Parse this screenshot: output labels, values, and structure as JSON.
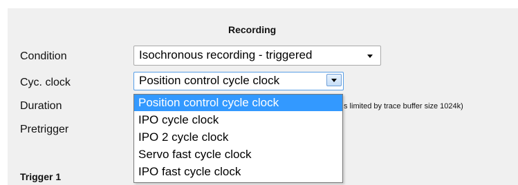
{
  "recording": {
    "title": "Recording",
    "condition": {
      "label": "Condition",
      "value": "Isochronous recording - triggered"
    },
    "cyc_clock": {
      "label": "Cyc. clock",
      "value": "Position control cycle clock",
      "options": [
        "Position control cycle clock",
        "IPO cycle clock",
        "IPO 2 cycle clock",
        "Servo fast cycle clock",
        "IPO fast cycle clock"
      ],
      "highlighted_index": 0
    },
    "duration": {
      "label": "Duration",
      "note_partial": "s limited by trace buffer size 1024k)"
    },
    "pretrigger": {
      "label": "Pretrigger"
    }
  },
  "trigger1": {
    "title": "Trigger 1"
  },
  "colors": {
    "panel_bg": "#f0f0f0",
    "selection_bg": "#3399ff",
    "selection_text": "#ffffff"
  }
}
